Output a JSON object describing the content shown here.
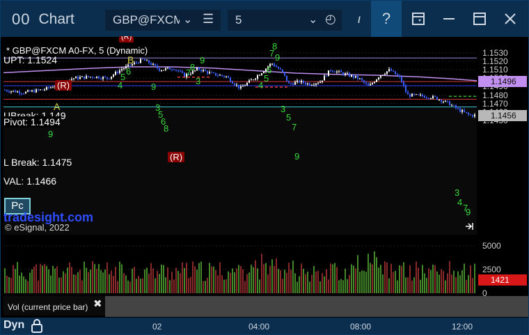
{
  "window": {
    "app_icon": "00",
    "app_title": "Chart",
    "symbol": "GBP@FXCM",
    "interval": "5",
    "help": "?",
    "italic_mark": "ι"
  },
  "chart": {
    "caption": "* GBP@FXCM A0-FX, 5 (Dynamic)",
    "copyright": "© eSignal, 2022",
    "watermark": "tradesight.com",
    "pc_box": "Pc",
    "levels": [
      {
        "label": "UPT: 1.1524",
        "price": 1.1524,
        "color": "#9b87d6"
      },
      {
        "label": "Pivot: 1.1494",
        "price": 1.1494,
        "color": "#d23b3b"
      },
      {
        "label": "L Break: 1.1475",
        "price": 1.1475,
        "color": "#c93434"
      },
      {
        "label": "VAL: 1.1466",
        "price": 1.1466,
        "color": "#3ec6d6"
      },
      {
        "label": "UBreak: 1.149",
        "price": 1.1497,
        "color": "#d23b3b"
      }
    ],
    "markers": {
      "a": "A",
      "b": "B",
      "r1": "(R)",
      "r2": "(R)",
      "r3": "(R)"
    },
    "price_ticks": [
      "1.1530",
      "1.1520",
      "1.1510",
      "1.1500",
      "1.1490",
      "1.1480",
      "1.1470",
      "1.1460",
      "1.1450"
    ],
    "last_price_tag": "1.1456",
    "ma_tag": "1.1496",
    "accent_ma": "#c08ff0",
    "bar_color": "#3a5fff",
    "candle_color": "#ffffff",
    "td_green": "#3adc3a"
  },
  "volume": {
    "tab_label": "Vol (current price bar)",
    "close": "✖",
    "ticks": [
      "5000",
      "2500",
      "0"
    ],
    "current_tag": "1421"
  },
  "time_axis": {
    "dyn": "Dyn",
    "labels": [
      "02",
      "04:00",
      "08:00",
      "12:00"
    ]
  }
}
